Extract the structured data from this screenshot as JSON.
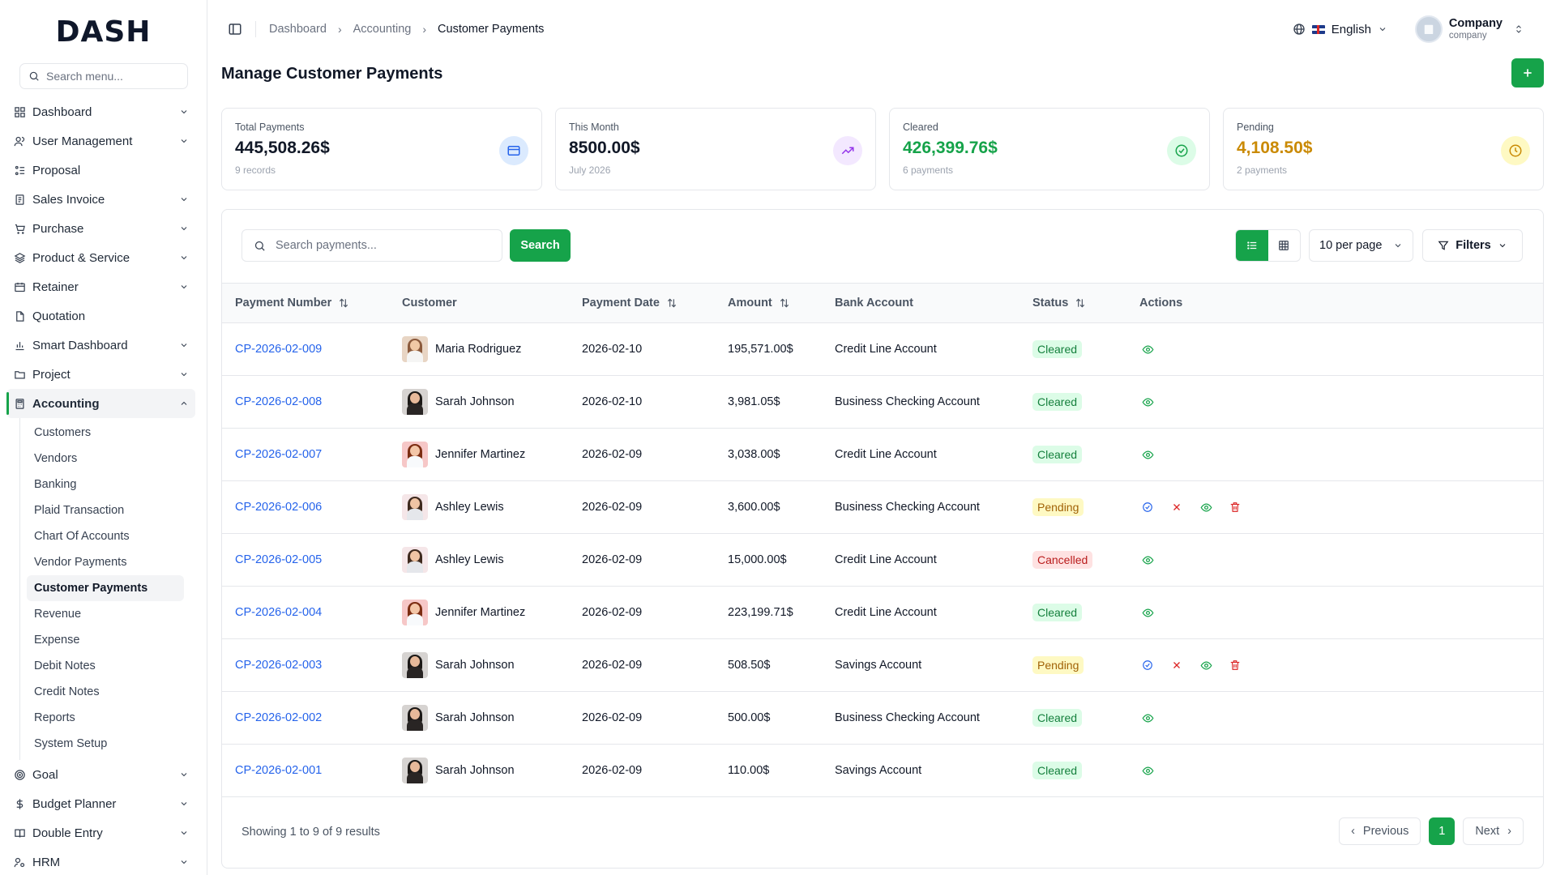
{
  "brand": {
    "logo": "DASH"
  },
  "sidebar": {
    "search_placeholder": "Search menu...",
    "items": [
      {
        "label": "Dashboard",
        "icon": "grid-icon",
        "chevron": true
      },
      {
        "label": "User Management",
        "icon": "users-icon",
        "chevron": true
      },
      {
        "label": "Proposal",
        "icon": "proposal-icon",
        "chevron": false
      },
      {
        "label": "Sales Invoice",
        "icon": "invoice-icon",
        "chevron": true
      },
      {
        "label": "Purchase",
        "icon": "cart-icon",
        "chevron": true
      },
      {
        "label": "Product & Service",
        "icon": "layers-icon",
        "chevron": true
      },
      {
        "label": "Retainer",
        "icon": "retainer-icon",
        "chevron": true
      },
      {
        "label": "Quotation",
        "icon": "file-icon",
        "chevron": false
      },
      {
        "label": "Smart Dashboard",
        "icon": "bar-chart-icon",
        "chevron": true
      },
      {
        "label": "Project",
        "icon": "folder-icon",
        "chevron": true
      },
      {
        "label": "Accounting",
        "icon": "calculator-icon",
        "chevron": true
      }
    ],
    "accounting_sub": [
      {
        "label": "Customers"
      },
      {
        "label": "Vendors"
      },
      {
        "label": "Banking"
      },
      {
        "label": "Plaid Transaction"
      },
      {
        "label": "Chart Of Accounts"
      },
      {
        "label": "Vendor Payments"
      },
      {
        "label": "Customer Payments"
      },
      {
        "label": "Revenue"
      },
      {
        "label": "Expense"
      },
      {
        "label": "Debit Notes"
      },
      {
        "label": "Credit Notes"
      },
      {
        "label": "Reports"
      },
      {
        "label": "System Setup"
      }
    ],
    "items_after": [
      {
        "label": "Goal",
        "icon": "target-icon"
      },
      {
        "label": "Budget Planner",
        "icon": "dollar-icon"
      },
      {
        "label": "Double Entry",
        "icon": "book-icon"
      },
      {
        "label": "HRM",
        "icon": "hrm-icon"
      }
    ]
  },
  "header": {
    "breadcrumb": [
      "Dashboard",
      "Accounting",
      "Customer Payments"
    ],
    "language": "English",
    "company_name": "Company",
    "company_sub": "company"
  },
  "page": {
    "title": "Manage Customer Payments"
  },
  "cards": [
    {
      "label": "Total Payments",
      "value": "445,508.26$",
      "sub": "9 records",
      "color": "#111827",
      "icon": "credit-card-icon",
      "icon_bg": "#dbeafe",
      "icon_color": "#2563eb"
    },
    {
      "label": "This Month",
      "value": "8500.00$",
      "sub": "July 2026",
      "color": "#111827",
      "icon": "trending-up-icon",
      "icon_bg": "#f3e8ff",
      "icon_color": "#9333ea"
    },
    {
      "label": "Cleared",
      "value": "426,399.76$",
      "sub": "6 payments",
      "color": "#16a34a",
      "icon": "check-circle-icon",
      "icon_bg": "#dcfce7",
      "icon_color": "#16a34a"
    },
    {
      "label": "Pending",
      "value": "4,108.50$",
      "sub": "2 payments",
      "color": "#ca8a04",
      "icon": "clock-icon",
      "icon_bg": "#fef9c3",
      "icon_color": "#ca8a04"
    }
  ],
  "toolbar": {
    "search_placeholder": "Search payments...",
    "search_button": "Search",
    "per_page": "10 per page",
    "filters": "Filters"
  },
  "table": {
    "headers": [
      "Payment Number",
      "Customer",
      "Payment Date",
      "Amount",
      "Bank Account",
      "Status",
      "Actions"
    ],
    "rows": [
      {
        "number": "CP-2026-02-009",
        "customer": "Maria Rodriguez",
        "avatar": "f1",
        "date": "2026-02-10",
        "amount": "195,571.00$",
        "bank": "Credit Line Account",
        "status": "Cleared"
      },
      {
        "number": "CP-2026-02-008",
        "customer": "Sarah Johnson",
        "avatar": "f2",
        "date": "2026-02-10",
        "amount": "3,981.05$",
        "bank": "Business Checking Account",
        "status": "Cleared"
      },
      {
        "number": "CP-2026-02-007",
        "customer": "Jennifer Martinez",
        "avatar": "f3",
        "date": "2026-02-09",
        "amount": "3,038.00$",
        "bank": "Credit Line Account",
        "status": "Cleared"
      },
      {
        "number": "CP-2026-02-006",
        "customer": "Ashley Lewis",
        "avatar": "f4",
        "date": "2026-02-09",
        "amount": "3,600.00$",
        "bank": "Business Checking Account",
        "status": "Pending"
      },
      {
        "number": "CP-2026-02-005",
        "customer": "Ashley Lewis",
        "avatar": "f4",
        "date": "2026-02-09",
        "amount": "15,000.00$",
        "bank": "Credit Line Account",
        "status": "Cancelled"
      },
      {
        "number": "CP-2026-02-004",
        "customer": "Jennifer Martinez",
        "avatar": "f3",
        "date": "2026-02-09",
        "amount": "223,199.71$",
        "bank": "Credit Line Account",
        "status": "Cleared"
      },
      {
        "number": "CP-2026-02-003",
        "customer": "Sarah Johnson",
        "avatar": "f2",
        "date": "2026-02-09",
        "amount": "508.50$",
        "bank": "Savings Account",
        "status": "Pending"
      },
      {
        "number": "CP-2026-02-002",
        "customer": "Sarah Johnson",
        "avatar": "f2",
        "date": "2026-02-09",
        "amount": "500.00$",
        "bank": "Business Checking Account",
        "status": "Cleared"
      },
      {
        "number": "CP-2026-02-001",
        "customer": "Sarah Johnson",
        "avatar": "f2",
        "date": "2026-02-09",
        "amount": "110.00$",
        "bank": "Savings Account",
        "status": "Cleared"
      }
    ]
  },
  "pagination": {
    "showing": "Showing 1 to 9 of 9 results",
    "previous": "Previous",
    "next": "Next",
    "current": "1"
  },
  "colors": {
    "accent": "#16a34a",
    "link": "#2563eb"
  }
}
